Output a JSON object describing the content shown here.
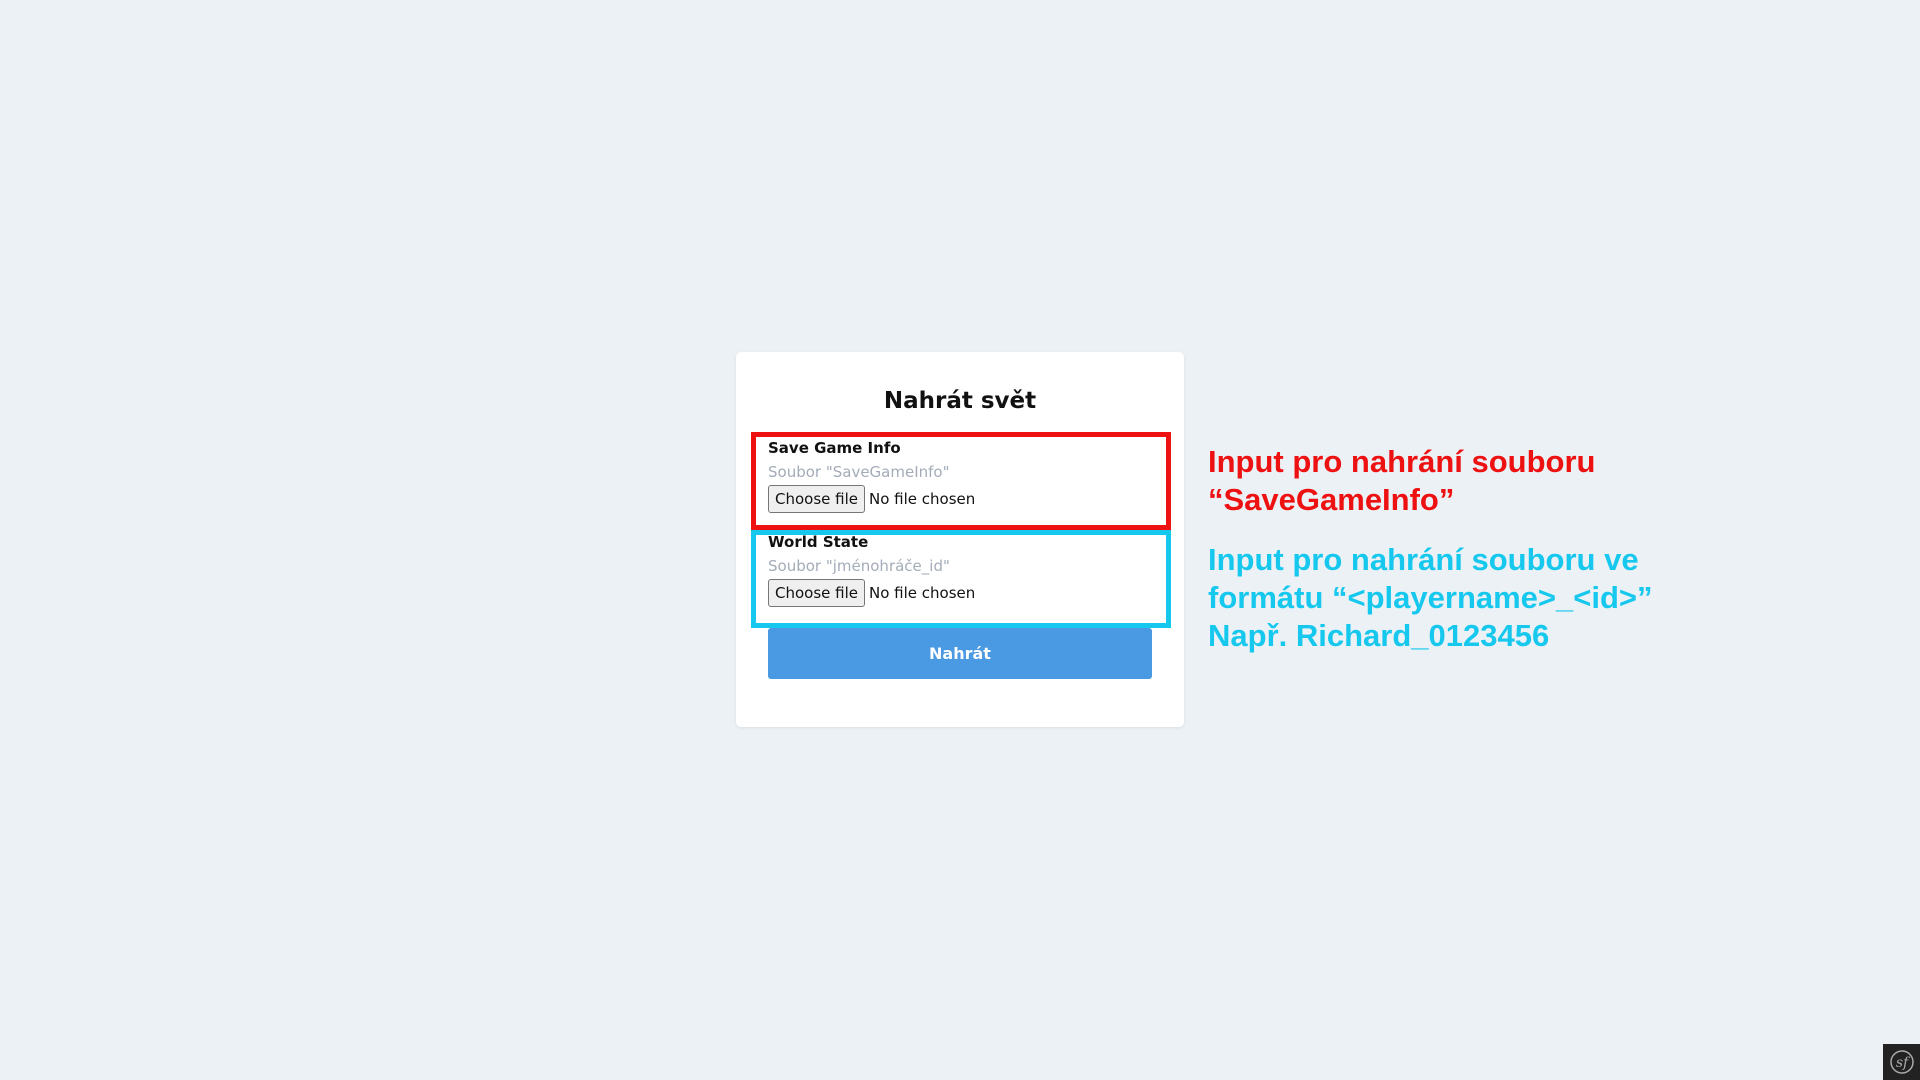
{
  "form": {
    "title": "Nahrát svět",
    "fields": [
      {
        "label": "Save Game Info",
        "hint": "Soubor \"SaveGameInfo\"",
        "button_label": "Choose file",
        "status": "No file chosen"
      },
      {
        "label": "World State",
        "hint": "Soubor \"jménohráče_id\"",
        "button_label": "Choose file",
        "status": "No file chosen"
      }
    ],
    "submit_label": "Nahrát"
  },
  "annotations": [
    {
      "color": "#ee1111",
      "lines": [
        "Input pro nahrání souboru",
        "“SaveGameInfo”"
      ]
    },
    {
      "color": "#16c8ee",
      "lines": [
        "Input pro nahrání souboru ve",
        "formátu “<playername>_<id>”",
        "Např. Richard_0123456"
      ]
    }
  ],
  "toolbar": {
    "icon": "symfony-icon"
  },
  "colors": {
    "background": "#ecf1f5",
    "card": "#ffffff",
    "primary_button": "#4a9ae3",
    "highlight_red": "#ee1111",
    "highlight_cyan": "#16c8ee"
  }
}
